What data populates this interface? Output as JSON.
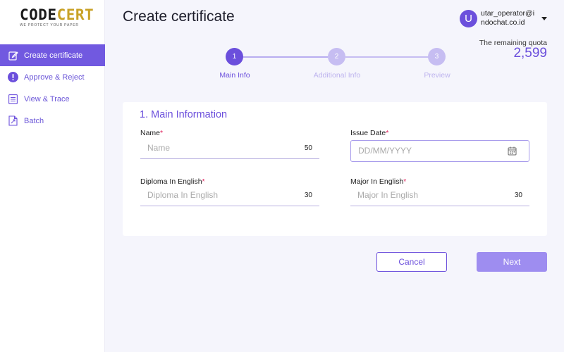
{
  "brand": {
    "logo_main_part1": "CODE",
    "logo_main_part2": "CERT",
    "tagline": "WE PROTECT YOUR PAPER"
  },
  "sidebar": {
    "items": [
      {
        "label": "Create certificate",
        "icon": "edit-icon",
        "active": true
      },
      {
        "label": "Approve & Reject",
        "icon": "alert-circle-icon",
        "active": false
      },
      {
        "label": "View & Trace",
        "icon": "document-list-icon",
        "active": false
      },
      {
        "label": "Batch",
        "icon": "batch-file-icon",
        "active": false
      }
    ]
  },
  "header": {
    "title": "Create certificate",
    "user": {
      "initial": "U",
      "email": "utar_operator@indochat.co.id"
    }
  },
  "quota": {
    "label": "The remaining quota",
    "value": "2,599"
  },
  "stepper": {
    "steps": [
      {
        "number": "1",
        "label": "Main Info",
        "state": "active"
      },
      {
        "number": "2",
        "label": "Additional Info",
        "state": "inactive"
      },
      {
        "number": "3",
        "label": "Preview",
        "state": "inactive"
      }
    ]
  },
  "form": {
    "section_title": "1. Main Information",
    "name": {
      "label": "Name",
      "required_mark": "*",
      "placeholder": "Name",
      "max": "50"
    },
    "issue_date": {
      "label": "Issue Date",
      "required_mark": "*",
      "placeholder": "DD/MM/YYYY",
      "icon": "calendar-icon"
    },
    "diploma": {
      "label": "Diploma In English",
      "required_mark": "*",
      "placeholder": "Diploma In English",
      "max": "30"
    },
    "major": {
      "label": "Major In English",
      "required_mark": "*",
      "placeholder": "Major In English",
      "max": "30"
    }
  },
  "actions": {
    "cancel_label": "Cancel",
    "next_label": "Next"
  },
  "colors": {
    "primary": "#6b4fdc",
    "sidebar_active": "#7159e0",
    "step_inactive": "#c6bdf2",
    "next_button": "#9e8df0",
    "logo_accent": "#c9a227",
    "required": "#e0245e"
  }
}
